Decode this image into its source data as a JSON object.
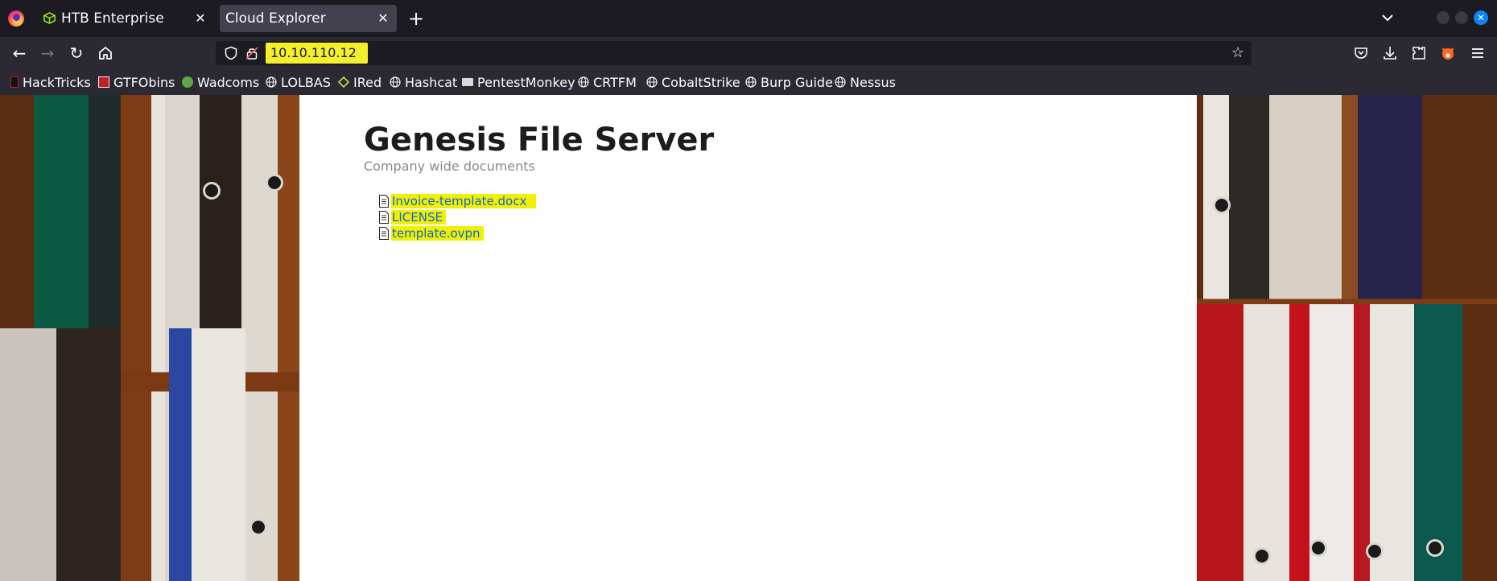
{
  "browser": {
    "tabs": [
      {
        "title": "HTB Enterprise",
        "icon": "htb-cube-icon",
        "active": false
      },
      {
        "title": "Cloud Explorer",
        "icon": "",
        "active": true
      }
    ],
    "url": "10.10.110.12",
    "bookmarks": [
      {
        "label": "HackTricks",
        "icon": "hacktricks-icon"
      },
      {
        "label": "GTFObins",
        "icon": "gtfobins-icon"
      },
      {
        "label": "Wadcoms",
        "icon": "wadcoms-icon"
      },
      {
        "label": "LOLBAS",
        "icon": "globe-icon"
      },
      {
        "label": "IRed",
        "icon": "ired-icon"
      },
      {
        "label": "Hashcat",
        "icon": "globe-icon"
      },
      {
        "label": "PentestMonkey",
        "icon": "pentestmonkey-icon"
      },
      {
        "label": "CRTFM",
        "icon": "globe-icon"
      },
      {
        "label": "CobaltStrike",
        "icon": "globe-icon"
      },
      {
        "label": "Burp Guide",
        "icon": "globe-icon"
      },
      {
        "label": "Nessus",
        "icon": "globe-icon"
      }
    ],
    "highlight_color": "#f3ef2c",
    "accent_color": "#0a84ff"
  },
  "page": {
    "title": "Genesis File Server",
    "subtitle": "Company wide documents",
    "files": [
      {
        "name": "Invoice-template.docx",
        "icon": "document-icon"
      },
      {
        "name": "LICENSE",
        "icon": "document-icon"
      },
      {
        "name": "template.ovpn",
        "icon": "document-icon"
      }
    ],
    "link_color": "#0a66d9",
    "highlight_color": "#f1f000"
  }
}
